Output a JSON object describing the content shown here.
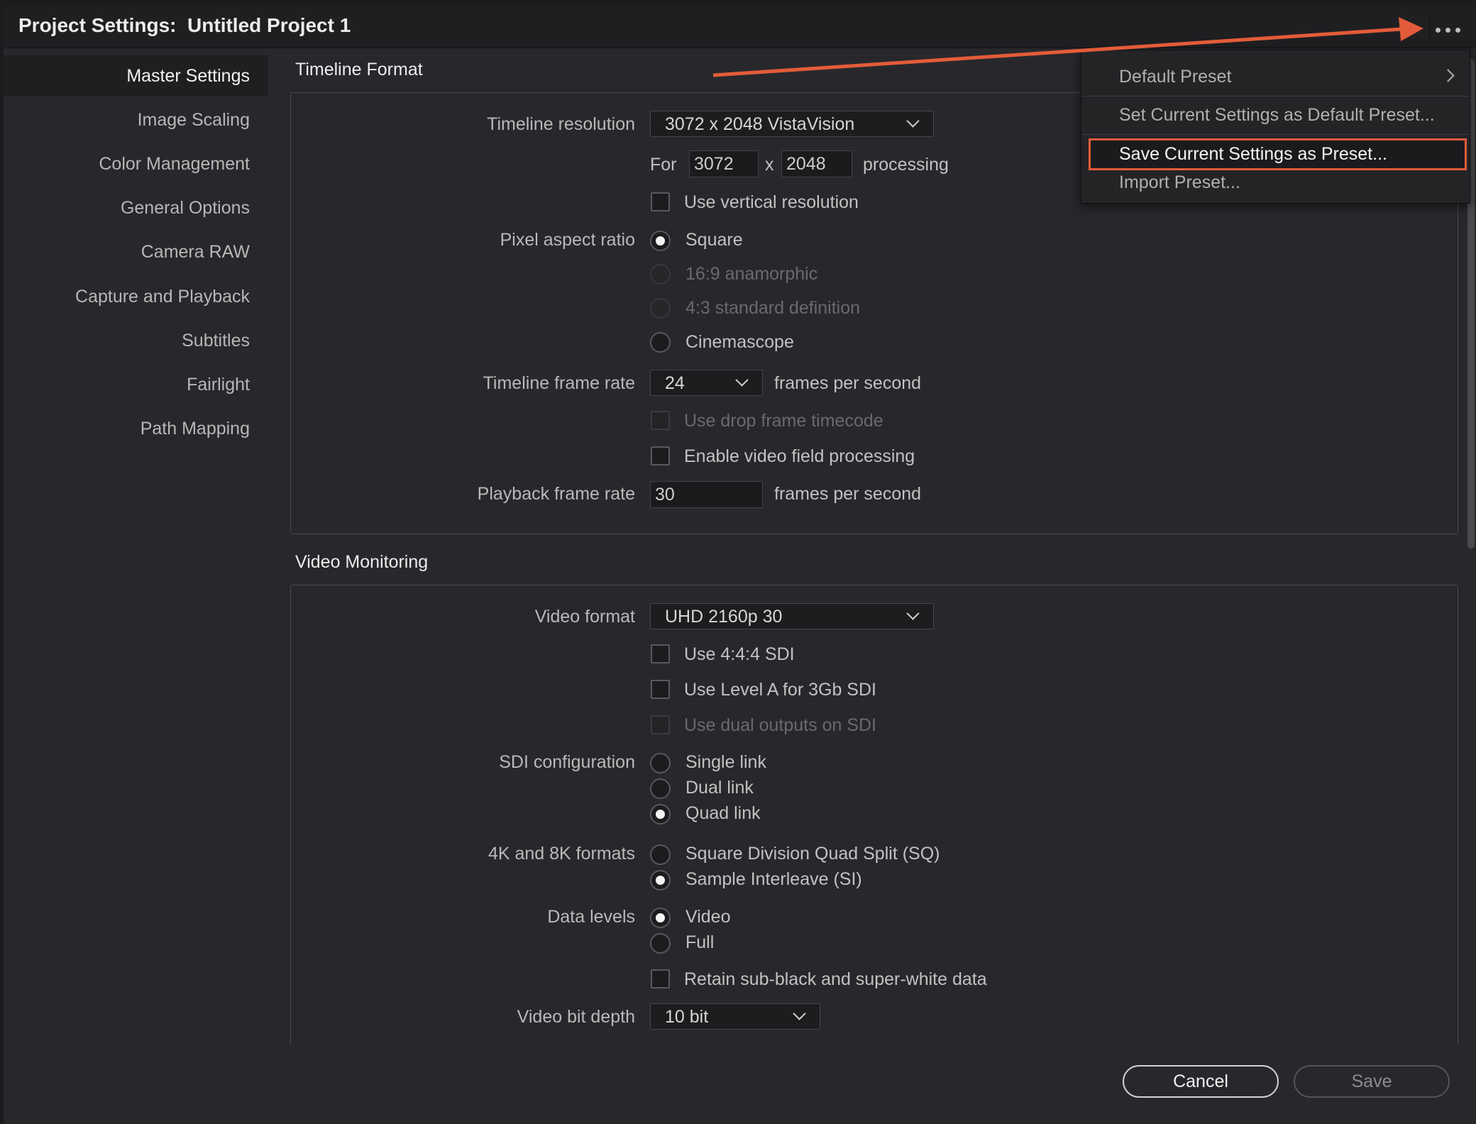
{
  "window": {
    "title": "Project Settings:  Untitled Project 1"
  },
  "sidebar": {
    "items": [
      {
        "label": "Master Settings"
      },
      {
        "label": "Image Scaling"
      },
      {
        "label": "Color Management"
      },
      {
        "label": "General Options"
      },
      {
        "label": "Camera RAW"
      },
      {
        "label": "Capture and Playback"
      },
      {
        "label": "Subtitles"
      },
      {
        "label": "Fairlight"
      },
      {
        "label": "Path Mapping"
      }
    ]
  },
  "timeline_format": {
    "title": "Timeline Format",
    "resolution_label": "Timeline resolution",
    "resolution_value": "3072 x 2048 VistaVision",
    "for_label": "For",
    "width": "3072",
    "x_label": "x",
    "height": "2048",
    "processing_label": "processing",
    "vertical_label": "Use vertical resolution",
    "par_label": "Pixel aspect ratio",
    "par_options": [
      "Square",
      "16:9 anamorphic",
      "4:3 standard definition",
      "Cinemascope"
    ],
    "frame_rate_label": "Timeline frame rate",
    "frame_rate_value": "24",
    "fps_label": "frames per second",
    "drop_frame_label": "Use drop frame timecode",
    "video_field_label": "Enable video field processing",
    "playback_rate_label": "Playback frame rate",
    "playback_rate_value": "30",
    "fps_label2": "frames per second"
  },
  "video_monitoring": {
    "title": "Video Monitoring",
    "format_label": "Video format",
    "format_value": "UHD 2160p 30",
    "sdi444_label": "Use 4:4:4 SDI",
    "levela_label": "Use Level A for 3Gb SDI",
    "dual_outputs_label": "Use dual outputs on SDI",
    "sdi_config_label": "SDI configuration",
    "sdi_options": [
      "Single link",
      "Dual link",
      "Quad link"
    ],
    "k48_label": "4K and 8K formats",
    "k48_options": [
      "Square Division Quad Split (SQ)",
      "Sample Interleave (SI)"
    ],
    "data_levels_label": "Data levels",
    "data_levels_options": [
      "Video",
      "Full"
    ],
    "retain_label": "Retain sub-black and super-white data",
    "bit_depth_label": "Video bit depth",
    "bit_depth_value": "10 bit"
  },
  "menu": {
    "items": [
      "Default Preset",
      "Set Current Settings as Default Preset...",
      "Save Current Settings as Preset...",
      "Import Preset..."
    ]
  },
  "footer": {
    "cancel": "Cancel",
    "save": "Save"
  },
  "colors": {
    "annotation": "#e35c3a",
    "background": "#28282c"
  }
}
